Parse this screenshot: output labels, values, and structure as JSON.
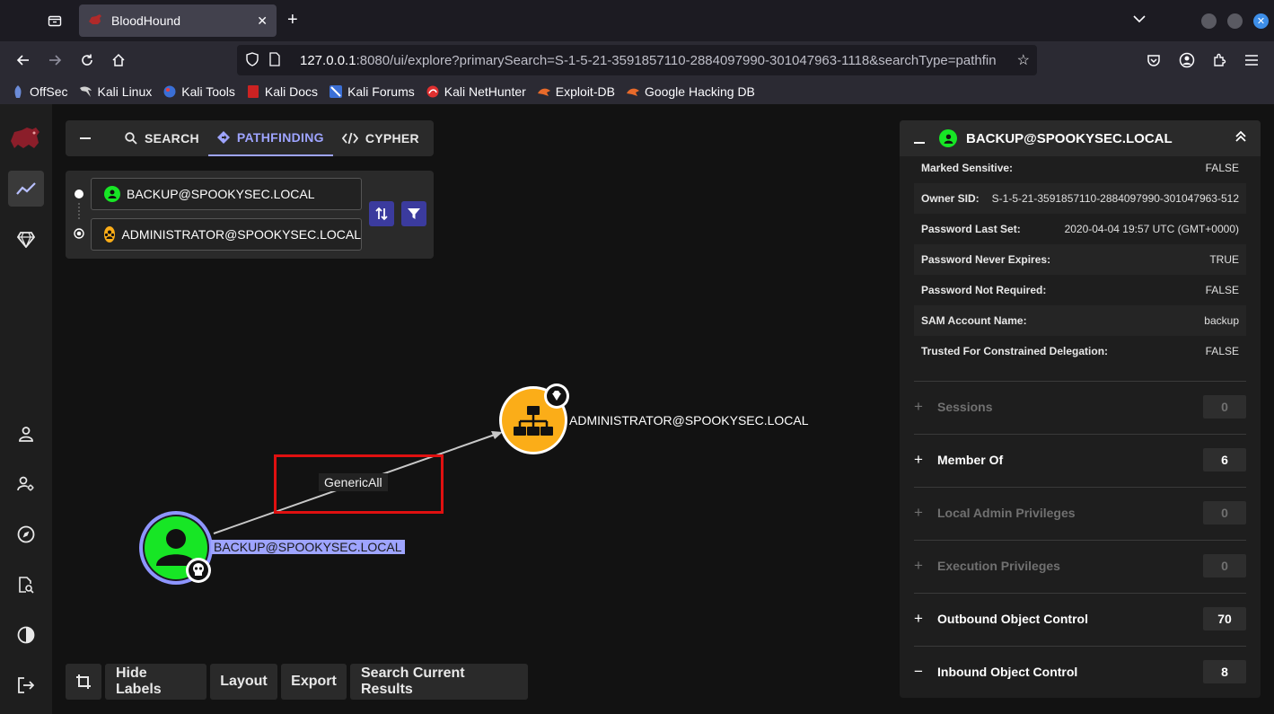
{
  "browser": {
    "tab_title": "BloodHound",
    "url_host": "127.0.0.1",
    "url_rest": ":8080/ui/explore?primarySearch=S-1-5-21-3591857110-2884097990-301047963-1118&searchType=pathfin",
    "bookmarks": [
      "OffSec",
      "Kali Linux",
      "Kali Tools",
      "Kali Docs",
      "Kali Forums",
      "Kali NetHunter",
      "Exploit-DB",
      "Google Hacking DB"
    ]
  },
  "explore": {
    "tabs": {
      "search": "SEARCH",
      "pathfinding": "PATHFINDING",
      "cypher": "CYPHER"
    },
    "start_node": "BACKUP@SPOOKYSEC.LOCAL",
    "end_node": "ADMINISTRATOR@SPOOKYSEC.LOCAL"
  },
  "graph": {
    "source_label": "BACKUP@SPOOKYSEC.LOCAL",
    "target_label": "ADMINISTRATOR@SPOOKYSEC.LOCAL",
    "edge_label": "GenericAll",
    "colors": {
      "user": "#17e625",
      "group": "#fbad18",
      "selected": "#9ea4ff",
      "highlight": "#e01010"
    }
  },
  "bottom_bar": {
    "hide_labels": "Hide Labels",
    "layout": "Layout",
    "export": "Export",
    "search_results": "Search Current Results"
  },
  "details": {
    "title": "BACKUP@SPOOKYSEC.LOCAL",
    "properties": [
      {
        "key": "Marked Sensitive:",
        "value": "FALSE"
      },
      {
        "key": "Owner SID:",
        "value": "S-1-5-21-3591857110-2884097990-301047963-512"
      },
      {
        "key": "Password Last Set:",
        "value": "2020-04-04 19:57 UTC (GMT+0000)"
      },
      {
        "key": "Password Never Expires:",
        "value": "TRUE"
      },
      {
        "key": "Password Not Required:",
        "value": "FALSE"
      },
      {
        "key": "SAM Account Name:",
        "value": "backup"
      },
      {
        "key": "Trusted For Constrained Delegation:",
        "value": "FALSE"
      }
    ],
    "sections": [
      {
        "label": "Sessions",
        "count": "0",
        "sign": "+"
      },
      {
        "label": "Member Of",
        "count": "6",
        "sign": "+"
      },
      {
        "label": "Local Admin Privileges",
        "count": "0",
        "sign": "+"
      },
      {
        "label": "Execution Privileges",
        "count": "0",
        "sign": "+"
      },
      {
        "label": "Outbound Object Control",
        "count": "70",
        "sign": "+"
      },
      {
        "label": "Inbound Object Control",
        "count": "8",
        "sign": "−"
      }
    ]
  }
}
